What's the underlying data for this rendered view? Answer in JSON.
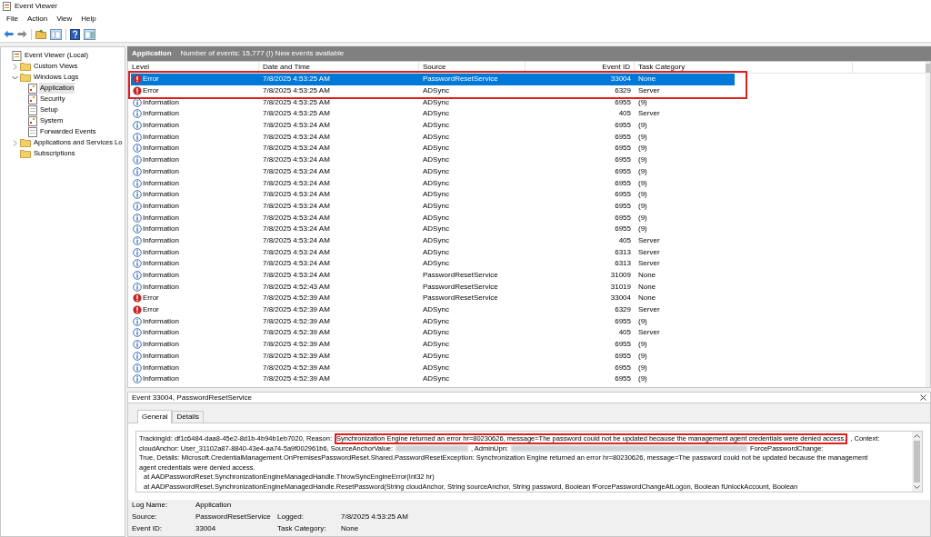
{
  "window": {
    "title": "Event Viewer"
  },
  "menu": [
    "File",
    "Action",
    "View",
    "Help"
  ],
  "tree": [
    {
      "label": "Event Viewer (Local)",
      "kind": "root",
      "selected": false,
      "children": [
        {
          "label": "Custom Views",
          "kind": "folder",
          "selected": false,
          "expanded": false
        },
        {
          "label": "Windows Logs",
          "kind": "folder",
          "selected": false,
          "expanded": true,
          "children": [
            {
              "label": "Application",
              "kind": "log",
              "selected": true
            },
            {
              "label": "Security",
              "kind": "log",
              "selected": false
            },
            {
              "label": "Setup",
              "kind": "plain",
              "selected": false
            },
            {
              "label": "System",
              "kind": "log",
              "selected": false
            },
            {
              "label": "Forwarded Events",
              "kind": "plain",
              "selected": false
            }
          ]
        },
        {
          "label": "Applications and Services Lo",
          "kind": "folder",
          "selected": false,
          "expanded": false
        },
        {
          "label": "Subscriptions",
          "kind": "folder",
          "selected": false
        }
      ]
    }
  ],
  "log_header": {
    "title": "Application",
    "summary": "Number of events: 15,777 (!) New events available"
  },
  "table": {
    "columns": [
      "Level",
      "Date and Time",
      "Source",
      "Event ID",
      "Task Category"
    ],
    "rows": [
      {
        "kind": "error",
        "severity": "Error",
        "time": "7/8/2025 4:53:25 AM",
        "source": "PasswordResetService",
        "event_id": "33004",
        "task": "None",
        "selected": true,
        "boxed": true
      },
      {
        "kind": "error",
        "severity": "Error",
        "time": "7/8/2025 4:53:25 AM",
        "source": "ADSync",
        "event_id": "6329",
        "task": "Server",
        "selected": false,
        "boxed": true
      },
      {
        "kind": "info",
        "severity": "Information",
        "time": "7/8/2025 4:53:25 AM",
        "source": "ADSync",
        "event_id": "6955",
        "task": "(9)",
        "selected": false,
        "boxed": false
      },
      {
        "kind": "info",
        "severity": "Information",
        "time": "7/8/2025 4:53:25 AM",
        "source": "ADSync",
        "event_id": "405",
        "task": "Server",
        "selected": false,
        "boxed": false
      },
      {
        "kind": "info",
        "severity": "Information",
        "time": "7/8/2025 4:53:24 AM",
        "source": "ADSync",
        "event_id": "6955",
        "task": "(9)",
        "selected": false,
        "boxed": false
      },
      {
        "kind": "info",
        "severity": "Information",
        "time": "7/8/2025 4:53:24 AM",
        "source": "ADSync",
        "event_id": "6955",
        "task": "(9)",
        "selected": false,
        "boxed": false
      },
      {
        "kind": "info",
        "severity": "Information",
        "time": "7/8/2025 4:53:24 AM",
        "source": "ADSync",
        "event_id": "6955",
        "task": "(9)",
        "selected": false,
        "boxed": false
      },
      {
        "kind": "info",
        "severity": "Information",
        "time": "7/8/2025 4:53:24 AM",
        "source": "ADSync",
        "event_id": "6955",
        "task": "(9)",
        "selected": false,
        "boxed": false
      },
      {
        "kind": "info",
        "severity": "Information",
        "time": "7/8/2025 4:53:24 AM",
        "source": "ADSync",
        "event_id": "6955",
        "task": "(9)",
        "selected": false,
        "boxed": false
      },
      {
        "kind": "info",
        "severity": "Information",
        "time": "7/8/2025 4:53:24 AM",
        "source": "ADSync",
        "event_id": "6955",
        "task": "(9)",
        "selected": false,
        "boxed": false
      },
      {
        "kind": "info",
        "severity": "Information",
        "time": "7/8/2025 4:53:24 AM",
        "source": "ADSync",
        "event_id": "6955",
        "task": "(9)",
        "selected": false,
        "boxed": false
      },
      {
        "kind": "info",
        "severity": "Information",
        "time": "7/8/2025 4:53:24 AM",
        "source": "ADSync",
        "event_id": "6955",
        "task": "(9)",
        "selected": false,
        "boxed": false
      },
      {
        "kind": "info",
        "severity": "Information",
        "time": "7/8/2025 4:53:24 AM",
        "source": "ADSync",
        "event_id": "6955",
        "task": "(9)",
        "selected": false,
        "boxed": false
      },
      {
        "kind": "info",
        "severity": "Information",
        "time": "7/8/2025 4:53:24 AM",
        "source": "ADSync",
        "event_id": "6955",
        "task": "(9)",
        "selected": false,
        "boxed": false
      },
      {
        "kind": "info",
        "severity": "Information",
        "time": "7/8/2025 4:53:24 AM",
        "source": "ADSync",
        "event_id": "405",
        "task": "Server",
        "selected": false,
        "boxed": false
      },
      {
        "kind": "info",
        "severity": "Information",
        "time": "7/8/2025 4:53:24 AM",
        "source": "ADSync",
        "event_id": "6313",
        "task": "Server",
        "selected": false,
        "boxed": false
      },
      {
        "kind": "info",
        "severity": "Information",
        "time": "7/8/2025 4:53:24 AM",
        "source": "ADSync",
        "event_id": "6313",
        "task": "Server",
        "selected": false,
        "boxed": false
      },
      {
        "kind": "info",
        "severity": "Information",
        "time": "7/8/2025 4:53:24 AM",
        "source": "PasswordResetService",
        "event_id": "31009",
        "task": "None",
        "selected": false,
        "boxed": false
      },
      {
        "kind": "info",
        "severity": "Information",
        "time": "7/8/2025 4:52:43 AM",
        "source": "PasswordResetService",
        "event_id": "31019",
        "task": "None",
        "selected": false,
        "boxed": false
      },
      {
        "kind": "error",
        "severity": "Error",
        "time": "7/8/2025 4:52:39 AM",
        "source": "PasswordResetService",
        "event_id": "33004",
        "task": "None",
        "selected": false,
        "boxed": false
      },
      {
        "kind": "error",
        "severity": "Error",
        "time": "7/8/2025 4:52:39 AM",
        "source": "ADSync",
        "event_id": "6329",
        "task": "Server",
        "selected": false,
        "boxed": false
      },
      {
        "kind": "info",
        "severity": "Information",
        "time": "7/8/2025 4:52:39 AM",
        "source": "ADSync",
        "event_id": "6955",
        "task": "(9)",
        "selected": false,
        "boxed": false
      },
      {
        "kind": "info",
        "severity": "Information",
        "time": "7/8/2025 4:52:39 AM",
        "source": "ADSync",
        "event_id": "405",
        "task": "Server",
        "selected": false,
        "boxed": false
      },
      {
        "kind": "info",
        "severity": "Information",
        "time": "7/8/2025 4:52:39 AM",
        "source": "ADSync",
        "event_id": "6955",
        "task": "(9)",
        "selected": false,
        "boxed": false
      },
      {
        "kind": "info",
        "severity": "Information",
        "time": "7/8/2025 4:52:39 AM",
        "source": "ADSync",
        "event_id": "6955",
        "task": "(9)",
        "selected": false,
        "boxed": false
      },
      {
        "kind": "info",
        "severity": "Information",
        "time": "7/8/2025 4:52:39 AM",
        "source": "ADSync",
        "event_id": "6955",
        "task": "(9)",
        "selected": false,
        "boxed": false
      },
      {
        "kind": "info",
        "severity": "Information",
        "time": "7/8/2025 4:52:39 AM",
        "source": "ADSync",
        "event_id": "6955",
        "task": "(9)",
        "selected": false,
        "boxed": false
      }
    ]
  },
  "details": {
    "title": "Event 33004, PasswordResetService",
    "tabs": [
      {
        "label": "General",
        "selected": true
      },
      {
        "label": "Details",
        "selected": false
      }
    ],
    "message": [
      [
        {
          "kind": "text",
          "text": "TrackingId: df1c6484-daa8-45e2-8d1b-4b94b1eb7020, Reason:"
        },
        {
          "kind": "highlight",
          "text": "Synchronization Engine returned an error hr=80230626, message=The password could not be updated because the management agent credentials were denied access."
        },
        {
          "kind": "text",
          "text": ", Context:"
        }
      ],
      [
        {
          "kind": "text",
          "text": "cloudAnchor: User_31102a87-8840-43e4-aa74-5a9f002961b6, SourceAnchorValue:"
        },
        {
          "kind": "redacted"
        },
        {
          "kind": "text",
          "text": ", AdminUpn:"
        },
        {
          "kind": "redacted"
        },
        {
          "kind": "text",
          "text": "ForcePasswordChange:"
        }
      ],
      [
        {
          "kind": "text",
          "text": "True, Details: Microsoft.CredentialManagement.OnPremisesPasswordReset.Shared.PasswordResetException: Synchronization Engine returned an error hr=80230626, message=The password could not be updated because the management"
        }
      ],
      [
        {
          "kind": "text",
          "text": "agent credentials were denied access."
        }
      ],
      [
        {
          "kind": "text",
          "text": "at AADPasswordReset.SynchronizationEngineManagedHandle.ThrowSyncEngineError(Int32 hr)"
        }
      ],
      [
        {
          "kind": "text",
          "text": "at AADPasswordReset.SynchronizationEngineManagedHandle.ResetPassword(String cloudAnchor, String sourceAnchor, String password, Boolean fForcePasswordChangeAtLogon, Boolean fUnlockAccount, Boolean"
        }
      ]
    ],
    "properties": [
      [
        {
          "label": "Log Name:",
          "value": "Application"
        }
      ],
      [
        {
          "label": "Source:",
          "value": "PasswordResetService"
        },
        {
          "label": "Logged:",
          "value": "7/8/2025 4:53:25 AM"
        }
      ],
      [
        {
          "label": "Event ID:",
          "value": "33004"
        },
        {
          "label": "Task Category:",
          "value": "None"
        }
      ]
    ]
  }
}
